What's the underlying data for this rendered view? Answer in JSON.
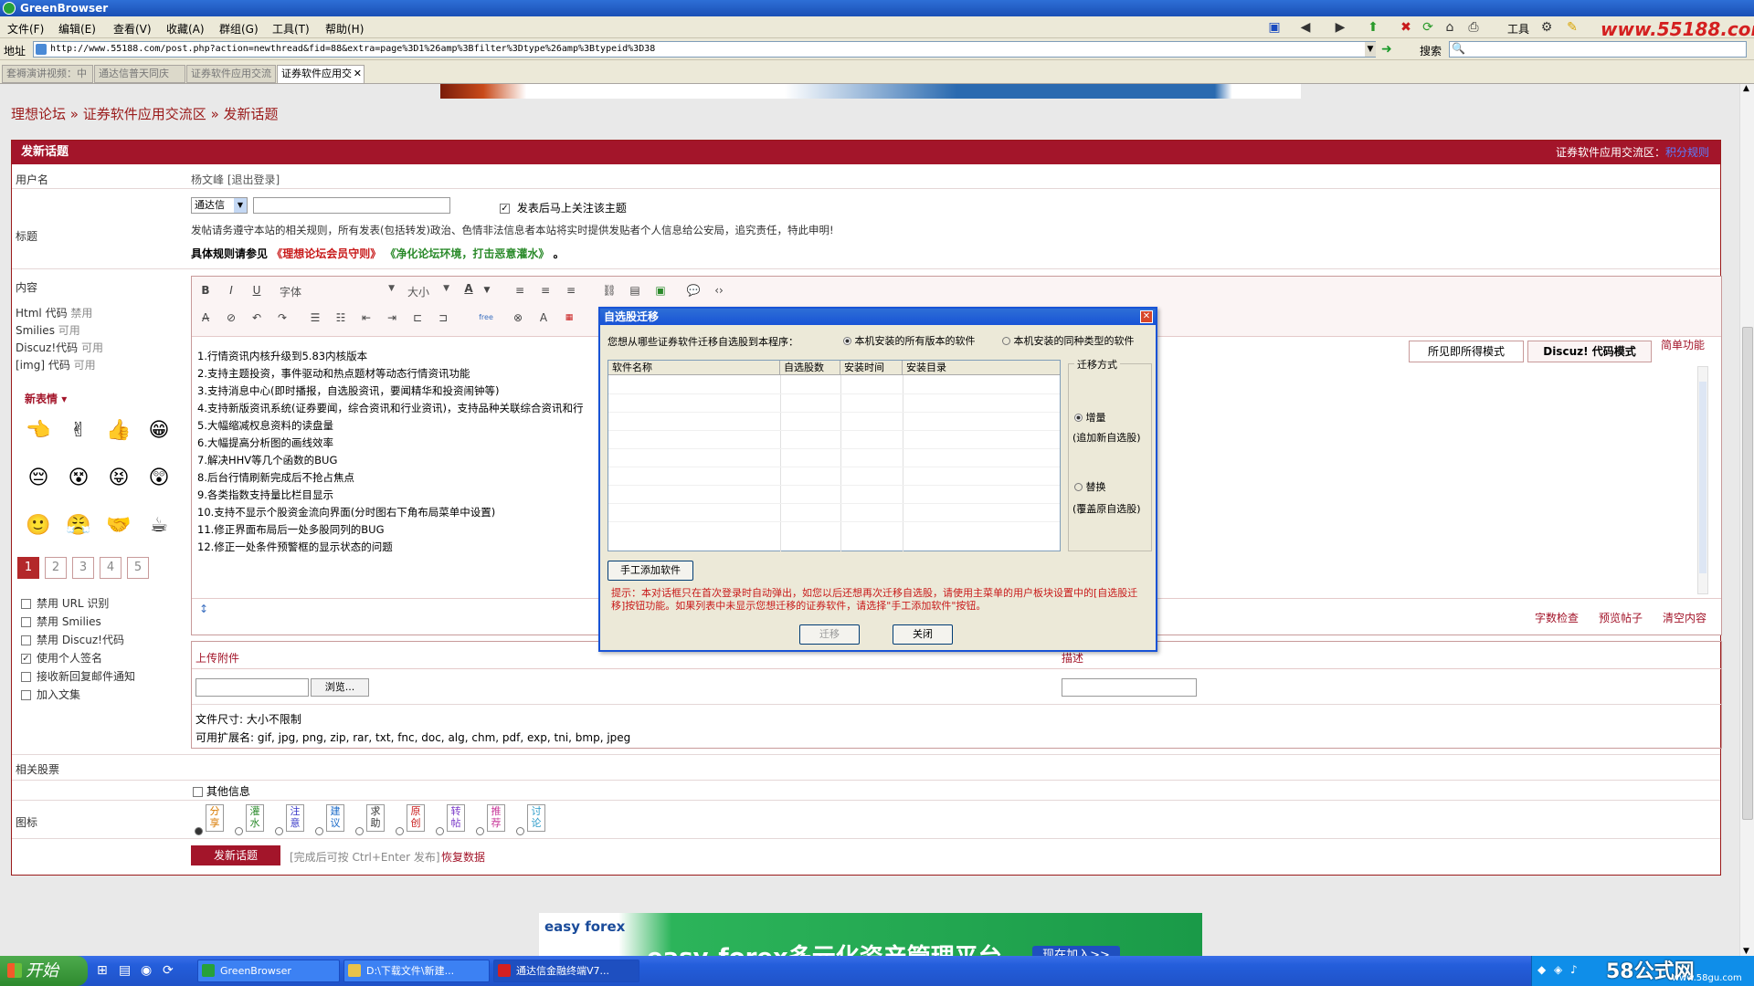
{
  "window": {
    "title": "GreenBrowser"
  },
  "menu": [
    "文件(F)",
    "编辑(E)",
    "查看(V)",
    "收藏(A)",
    "群组(G)",
    "工具(T)",
    "帮助(H)"
  ],
  "toolbar": {
    "tools_label": "工具",
    "watermark": "www.55188.com"
  },
  "address": {
    "label": "地址",
    "url": "http://www.55188.com/post.php?action=newthread&fid=88&extra=page%3D1%26amp%3Bfilter%3Dtype%26amp%3Btypeid%3D38"
  },
  "search": {
    "label": "搜索"
  },
  "tabs": [
    {
      "label": "套褥演讲视频：中"
    },
    {
      "label": "通达信普天同庆"
    },
    {
      "label": "证券软件应用交流"
    },
    {
      "label": "证券软件应用交"
    }
  ],
  "breadcrumb": {
    "home": "理想论坛",
    "sep": "»",
    "forum": "证券软件应用交流区",
    "page": "发新话题"
  },
  "form": {
    "header": "发新话题",
    "header_right": "证券软件应用交流区：",
    "header_right_link": "积分规则",
    "username_label": "用户名",
    "username_value": "杨文峰 [退出登录]",
    "subject_label": "标题",
    "subject_type": "通达信",
    "follow_check": "发表后马上关注该主题",
    "rules_notice": "发帖请务遵守本站的相关规则，所有发表(包括转发)政治、色情非法信息者本站将实时提供发贴者个人信息给公安局，追究责任，特此申明!",
    "rules_ref_prefix": "具体规则请参见",
    "rules_ref_1": "《理想论坛会员守则》",
    "rules_ref_2": "《净化论坛环境，打击恶意灌水》",
    "rules_ref_end": "。",
    "content_label": "内容",
    "html_code": "Html 代码",
    "html_state": "禁用",
    "smilies": "Smilies",
    "smilies_state": "可用",
    "discuz_code": "Discuz!代码",
    "discuz_state": "可用",
    "img_code": "[img] 代码",
    "img_state": "可用",
    "emoji_title": "新表情",
    "pages": [
      "1",
      "2",
      "3",
      "4",
      "5"
    ],
    "options": [
      {
        "label": "禁用 URL 识别",
        "checked": false
      },
      {
        "label": "禁用 Smilies",
        "checked": false
      },
      {
        "label": "禁用 Discuz!代码",
        "checked": false
      },
      {
        "label": "使用个人签名",
        "checked": true
      },
      {
        "label": "接收新回复邮件通知",
        "checked": false
      },
      {
        "label": "加入文集",
        "checked": false
      }
    ],
    "related_label": "相关股票",
    "other_info": "其他信息",
    "icon_label": "图标",
    "post_icons": [
      "分享",
      "灌水",
      "注意",
      "建议",
      "求助",
      "原创",
      "转帖",
      "推荐",
      "讨论"
    ],
    "submit": "发新话题",
    "submit_hint": "[完成后可按 Ctrl+Enter 发布]",
    "restore": "恢复数据"
  },
  "editor": {
    "font_label": "字体",
    "size_label": "大小",
    "mode_wysiwyg": "所见即所得模式",
    "mode_code": "Discuz! 代码模式",
    "simple": "简单功能",
    "lines": [
      "1.行情资讯内核升级到5.83内核版本",
      "2.支持主题投资，事件驱动和热点题材等动态行情资讯功能",
      "3.支持消息中心(即时播报，自选股资讯，要闻精华和投资闹钟等)",
      "4.支持新版资讯系统(证券要闻，综合资讯和行业资讯)，支持品种关联综合资讯和行",
      "5.大幅缩减权息资料的读盘量",
      "6.大幅提高分析图的画线效率",
      "7.解决HHV等几个函数的BUG",
      "8.后台行情刷新完成后不抢占焦点",
      "9.各类指数支持量比栏目显示",
      "10.支持不显示个股资金流向界面(分时图右下角布局菜单中设置)",
      "11.修正界面布局后一处多股同列的BUG",
      "12.修正一处条件预警框的显示状态的问题"
    ],
    "word_check": "字数检查",
    "preview": "预览帖子",
    "clear": "清空内容"
  },
  "attachment": {
    "upload_label": "上传附件",
    "desc_label": "描述",
    "browse": "浏览...",
    "size_info": "文件尺寸: 大小不限制",
    "ext_info": "可用扩展名: gif, jpg, png, zip, rar, txt, fnc, doc, alg, chm, pdf, exp, tni, bmp, jpeg"
  },
  "dialog": {
    "title": "自选股迁移",
    "question": "您想从哪些证券软件迁移自选股到本程序：",
    "opt_all": "本机安装的所有版本的软件",
    "opt_same": "本机安装的同种类型的软件",
    "columns": [
      "软件名称",
      "自选股数",
      "安装时间",
      "安装目录"
    ],
    "mode_group": "迁移方式",
    "mode_add": "增量",
    "mode_add_desc": "(追加新自选股)",
    "mode_replace": "替换",
    "mode_replace_desc": "(覆盖原自选股)",
    "manual_add": "手工添加软件",
    "tip": "提示：本对话框只在首次登录时自动弹出，如您以后还想再次迁移自选股，请使用主菜单的用户板块设置中的[自选股迁移]按钮功能。如果列表中未显示您想迁移的证券软件，请选择\"手工添加软件\"按钮。",
    "migrate": "迁移",
    "close": "关闭"
  },
  "banner": {
    "brand": "easy forex",
    "slogan": "easy-forex多元化资产管理平台",
    "join": "现在加入>>"
  },
  "taskbar": {
    "start": "开始",
    "tasks": [
      "GreenBrowser",
      "D:\\下载文件\\新建...",
      "通达信金融终端V7..."
    ],
    "watermark": "58公式网",
    "watermark_url": "www.58gu.com"
  }
}
